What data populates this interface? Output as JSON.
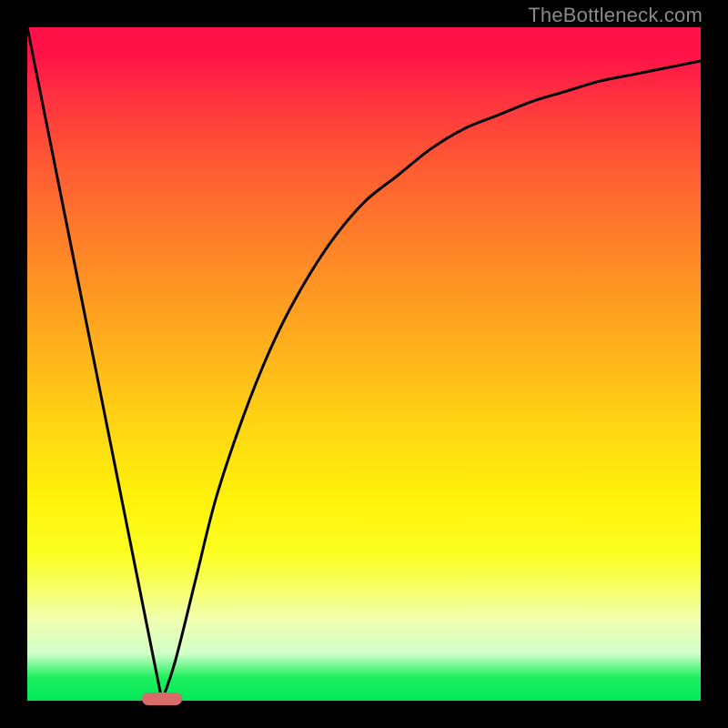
{
  "watermark": "TheBottleneck.com",
  "chart_data": {
    "type": "line",
    "title": "",
    "xlabel": "",
    "ylabel": "",
    "xlim": [
      0,
      100
    ],
    "ylim": [
      0,
      100
    ],
    "grid": false,
    "series": [
      {
        "name": "bottleneck-curve",
        "x": [
          0,
          5,
          10,
          15,
          18,
          20,
          22,
          25,
          28,
          32,
          36,
          40,
          45,
          50,
          55,
          60,
          65,
          70,
          75,
          80,
          85,
          90,
          95,
          100
        ],
        "values": [
          100,
          75,
          50,
          25,
          10,
          0,
          6,
          18,
          30,
          42,
          52,
          60,
          68,
          74,
          78,
          82,
          85,
          87,
          89,
          90.5,
          92,
          93,
          94,
          95
        ]
      }
    ],
    "marker": {
      "center_x": 20,
      "y": 0,
      "width": 6
    },
    "background_gradient": {
      "top": "#ff1248",
      "bottom": "#00e858"
    }
  }
}
